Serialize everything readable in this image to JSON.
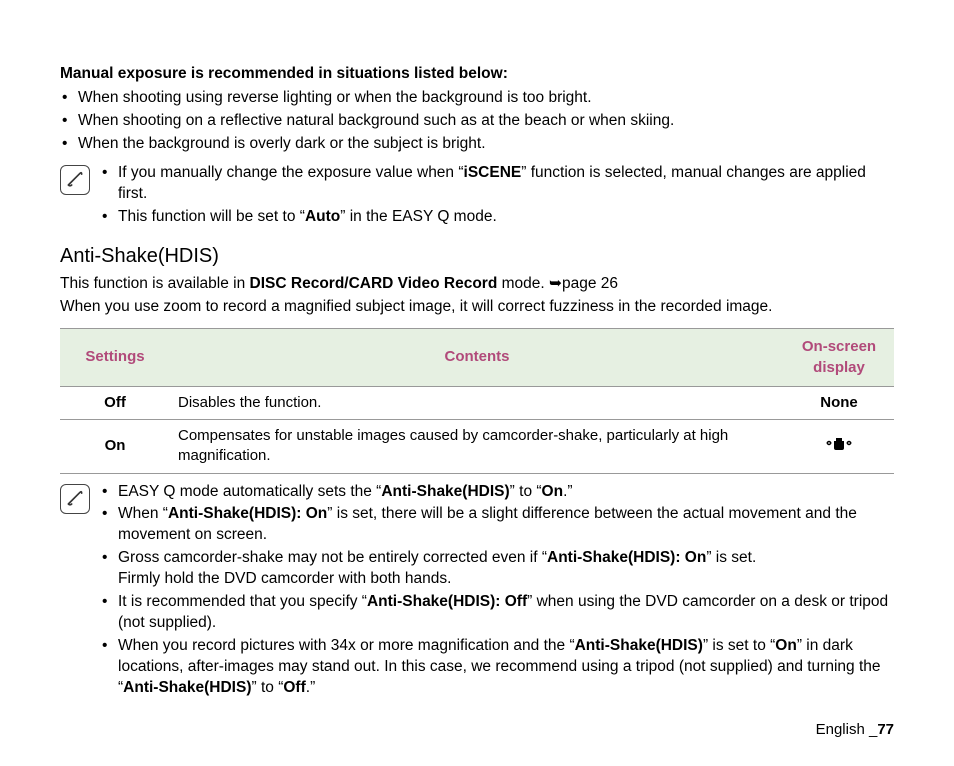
{
  "intro": {
    "heading": "Manual exposure is recommended in situations listed below:",
    "bullets": [
      "When shooting using reverse lighting or when the background is too bright.",
      "When shooting on a reflective natural background such as at the beach or when skiing.",
      "When the background is overly dark or the subject is bright."
    ]
  },
  "note1": {
    "line1_pre": "If you manually change the exposure value when “",
    "line1_b1": "iSCENE",
    "line1_post": "” function is selected, manual changes are applied first.",
    "line2_pre": "This function will be set to “",
    "line2_b1": "Auto",
    "line2_post": "” in the EASY Q mode."
  },
  "section": {
    "title": "Anti-Shake(HDIS)",
    "desc_pre": "This function is available in ",
    "desc_b": "DISC Record/CARD Video Record",
    "desc_post": " mode. ➥page 26",
    "desc2": "When you use zoom to record a magnified subject image, it will correct fuzziness in the recorded image."
  },
  "table": {
    "headers": {
      "settings": "Settings",
      "contents": "Contents",
      "display": "On-screen display"
    },
    "rows": [
      {
        "setting": "Off",
        "content": "Disables the function.",
        "display_text": "None",
        "display_icon": false
      },
      {
        "setting": "On",
        "content": "Compensates for unstable images caused by camcorder-shake, particularly at high magnification.",
        "display_text": "",
        "display_icon": true
      }
    ]
  },
  "note2": {
    "b1_pre": "EASY Q mode automatically sets the “",
    "b1_b1": "Anti-Shake(HDIS)",
    "b1_mid": "” to “",
    "b1_b2": "On",
    "b1_post": ".”",
    "b2_pre": "When “",
    "b2_b1": "Anti-Shake(HDIS): On",
    "b2_post": "” is set, there will be a slight difference between the actual movement and the movement on screen.",
    "b3_pre": "Gross camcorder-shake may not be entirely corrected even if “",
    "b3_b1": "Anti-Shake(HDIS): On",
    "b3_post": "” is set.",
    "b3_line2": "Firmly hold the DVD camcorder with both hands.",
    "b4_pre": "It is recommended that you specify “",
    "b4_b1": "Anti-Shake(HDIS): Off",
    "b4_post": "” when using the DVD camcorder on a desk or tripod (not supplied).",
    "b5_pre": "When you record pictures with 34x or more magnification and the “",
    "b5_b1": "Anti-Shake(HDIS)",
    "b5_mid1": "” is set to “",
    "b5_b2": "On",
    "b5_mid2": "” in dark locations, after-images may stand out. In this case, we recommend using a tripod (not supplied) and turning the “",
    "b5_b3": "Anti-Shake(HDIS)",
    "b5_mid3": "” to “",
    "b5_b4": "Off",
    "b5_post": ".”"
  },
  "footer": {
    "lang": "English ",
    "page_pre": "_",
    "page": "77"
  }
}
